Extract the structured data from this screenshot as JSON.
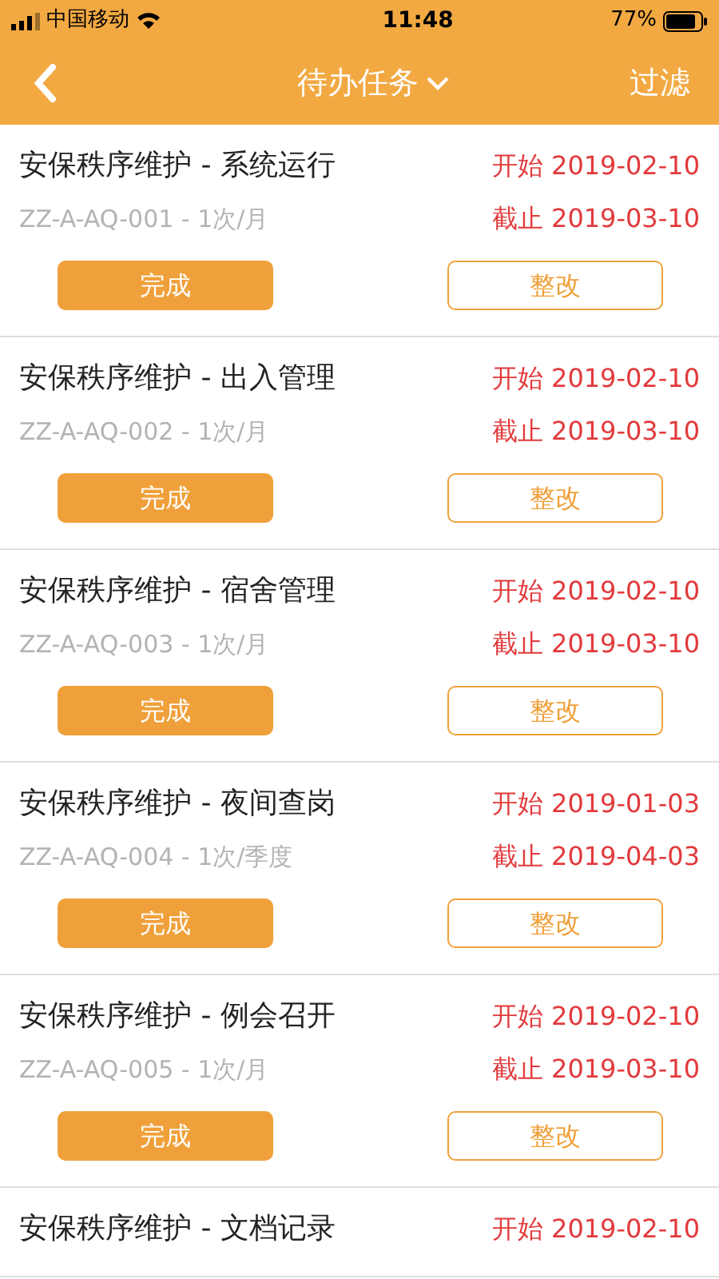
{
  "status_bar": {
    "carrier": "中国移动",
    "time": "11:48",
    "battery": "77%"
  },
  "nav": {
    "title": "待办任务",
    "filter": "过滤"
  },
  "tasks": [
    {
      "title": "安保秩序维护 - 系统运行",
      "code": "ZZ-A-AQ-001 - 1次/月",
      "start": "开始 2019-02-10",
      "end": "截止 2019-03-10",
      "buttons": [
        "完成",
        "整改"
      ]
    },
    {
      "title": "安保秩序维护 - 出入管理",
      "code": "ZZ-A-AQ-002 - 1次/月",
      "start": "开始 2019-02-10",
      "end": "截止 2019-03-10",
      "buttons": [
        "完成",
        "整改"
      ]
    },
    {
      "title": "安保秩序维护 - 宿舍管理",
      "code": "ZZ-A-AQ-003 - 1次/月",
      "start": "开始 2019-02-10",
      "end": "截止 2019-03-10",
      "buttons": [
        "完成",
        "整改"
      ]
    },
    {
      "title": "安保秩序维护 - 夜间查岗",
      "code": "ZZ-A-AQ-004 - 1次/季度",
      "start": "开始 2019-01-03",
      "end": "截止 2019-04-03",
      "buttons": [
        "完成",
        "整改"
      ]
    },
    {
      "title": "安保秩序维护 - 例会召开",
      "code": "ZZ-A-AQ-005 - 1次/月",
      "start": "开始 2019-02-10",
      "end": "截止 2019-03-10",
      "buttons": [
        "完成",
        "整改"
      ]
    },
    {
      "title": "安保秩序维护 - 文档记录",
      "start": "开始 2019-02-10"
    }
  ]
}
